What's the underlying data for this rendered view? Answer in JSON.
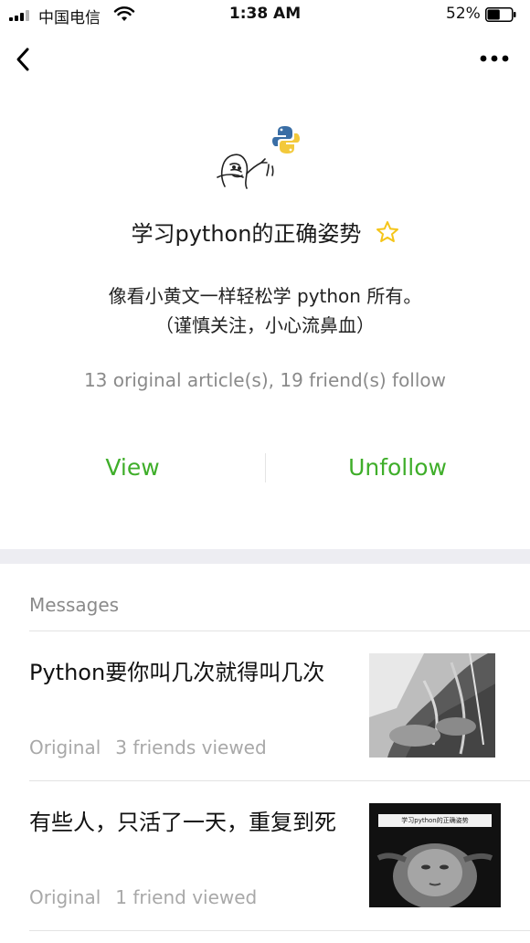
{
  "status_bar": {
    "carrier": "中国电信",
    "time": "1:38 AM",
    "battery_percent": "52%",
    "battery_level": 0.52
  },
  "nav": {
    "back_icon": "chevron-left-icon",
    "more_icon": "ellipsis-icon"
  },
  "profile": {
    "name": "学习python的正确姿势",
    "star_icon": "star-outline-icon",
    "star_color": "#f5c518",
    "description_line1": "像看小黄文一样轻松学 python 所有。",
    "description_line2": "（谨慎关注，小心流鼻血）",
    "stats": "13 original article(s), 19 friend(s) follow"
  },
  "actions": {
    "view_label": "View",
    "unfollow_label": "Unfollow",
    "accent_color": "#3fae2a"
  },
  "messages": {
    "title": "Messages",
    "articles": [
      {
        "title": "Python要你叫几次就得叫几次",
        "tag": "Original",
        "views": "3 friends viewed"
      },
      {
        "title": "有些人，只活了一天，重复到死",
        "tag": "Original",
        "views": "1 friend viewed",
        "thumb_caption": "学习python的正确姿势"
      }
    ]
  }
}
